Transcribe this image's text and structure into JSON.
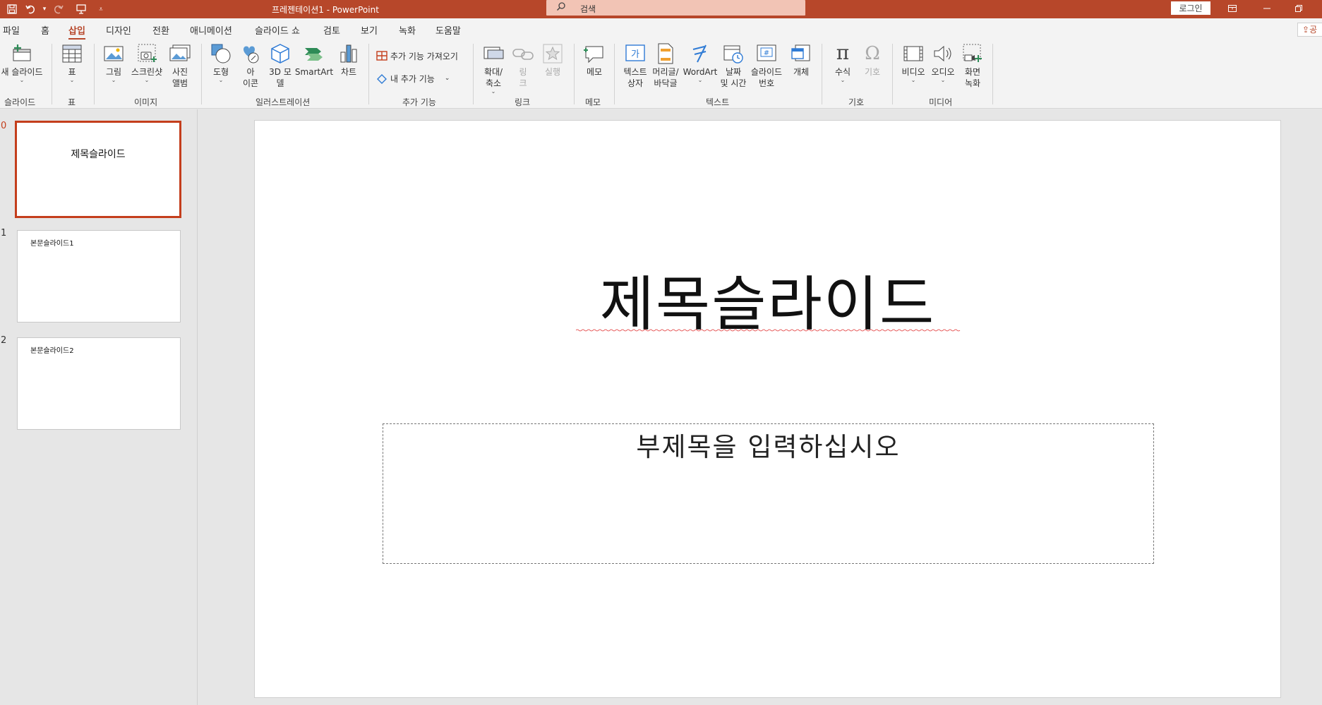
{
  "titlebar": {
    "doc_title": "프레젠테이션1  -  PowerPoint",
    "search_label": "검색",
    "login_label": "로그인",
    "quick_access": [
      "save-icon",
      "undo-icon",
      "redo-icon",
      "start-from-beginning-icon",
      "customize-icon"
    ]
  },
  "tabs": [
    "파일",
    "홈",
    "삽입",
    "디자인",
    "전환",
    "애니메이션",
    "슬라이드 쇼",
    "검토",
    "보기",
    "녹화",
    "도움말"
  ],
  "active_tab": "삽입",
  "share_label": "공",
  "ribbon": {
    "buttons": {
      "new_slide": "새 슬라이드",
      "table": "표",
      "picture": "그림",
      "screenshot": "스크린샷",
      "photo_album": "사진\n앨범",
      "shapes": "도형",
      "icons": "아\n이콘",
      "model3d": "3D 모\n델",
      "smartart": "SmartArt",
      "chart": "차트",
      "get_addins": "추가 기능 가져오기",
      "my_addins": "내 추가 기능",
      "zoom": "확대/\n축소",
      "link": "링\n크",
      "action": "실행",
      "comment": "메모",
      "textbox": "텍스트\n상자",
      "header_footer": "머리글/\n바닥글",
      "wordart": "WordArt",
      "date_time": "날짜\n및 시간",
      "slide_number": "슬라이드\n번호",
      "object": "개체",
      "equation": "수식",
      "symbol": "기호",
      "video": "비디오",
      "audio": "오디오",
      "screen_recording": "화면\n녹화"
    },
    "groups": {
      "slides": "슬라이드",
      "tables": "표",
      "images": "이미지",
      "illustrations": "일러스트레이션",
      "addins": "추가 기능",
      "links": "링크",
      "comments": "메모",
      "text": "텍스트",
      "symbols": "기호",
      "media": "미디어"
    }
  },
  "thumbnails": [
    {
      "number": "0",
      "text": "제목슬라이드",
      "selected": true
    },
    {
      "number": "1",
      "text": "본문슬라이드1",
      "selected": false
    },
    {
      "number": "2",
      "text": "본문슬라이드2",
      "selected": false
    }
  ],
  "slide": {
    "title": "제목슬라이드",
    "subtitle_placeholder": "부제목을 입력하십시오"
  },
  "colors": {
    "accent": "#b7472a",
    "search_bg": "#f2c4b5",
    "selected_thumb_border": "#c43e1c"
  }
}
